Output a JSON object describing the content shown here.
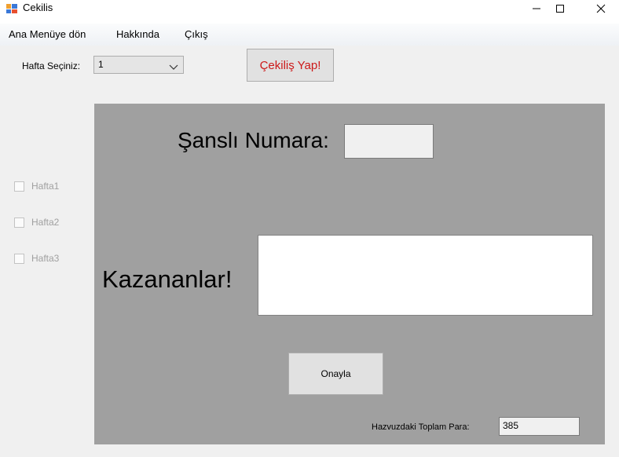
{
  "window": {
    "title": "Cekilis",
    "minimize_icon": "minimize-icon",
    "maximize_icon": "maximize-icon",
    "close_icon": "close-icon"
  },
  "menu": {
    "items": [
      {
        "label": "Ana Menüye dön"
      },
      {
        "label": "Hakkında"
      },
      {
        "label": "Çıkış"
      }
    ]
  },
  "top": {
    "week_label": "Hafta Seçiniz:",
    "week_select_value": "1",
    "draw_button_label": "Çekiliş Yap!",
    "draw_button_color": "#cc1818"
  },
  "checkboxes": [
    {
      "label": "Hafta1",
      "checked": false,
      "enabled": false
    },
    {
      "label": "Hafta2",
      "checked": false,
      "enabled": false
    },
    {
      "label": "Hafta3",
      "checked": false,
      "enabled": false
    }
  ],
  "panel": {
    "background": "#a0a0a0",
    "lucky_number_label": "Şanslı Numara:",
    "lucky_number_value": "",
    "winners_label": "Kazananlar!",
    "winners_value": "",
    "confirm_button_label": "Onayla",
    "total_label": "Hazvuzdaki Toplam Para:",
    "total_value": "385"
  }
}
